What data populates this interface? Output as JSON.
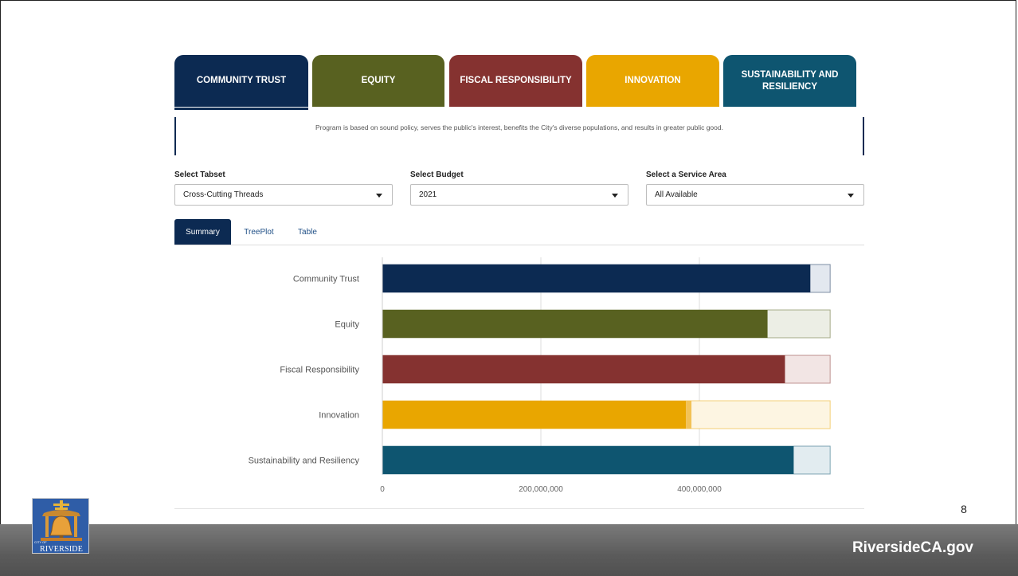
{
  "tabs": [
    {
      "label": "COMMUNITY TRUST",
      "color": "#0c2a52",
      "active": true
    },
    {
      "label": "EQUITY",
      "color": "#586120",
      "active": false
    },
    {
      "label": "FISCAL RESPONSIBILITY",
      "color": "#853230",
      "active": false
    },
    {
      "label": "INNOVATION",
      "color": "#e9a600",
      "active": false
    },
    {
      "label": "SUSTAINABILITY AND RESILIENCY",
      "color": "#0e5570",
      "active": false
    }
  ],
  "description": "Program is based on sound policy, serves the public's interest, benefits the City's diverse populations, and results in greater public good.",
  "selects": {
    "tabset": {
      "label": "Select Tabset",
      "value": "Cross-Cutting Threads"
    },
    "budget": {
      "label": "Select Budget",
      "value": "2021"
    },
    "service_area": {
      "label": "Select a Service Area",
      "value": "All Available"
    }
  },
  "subtabs": [
    "Summary",
    "TreePlot",
    "Table"
  ],
  "chart_data": {
    "type": "bar",
    "orientation": "horizontal",
    "stacked": true,
    "categories": [
      "Community Trust",
      "Equity",
      "Fiscal Responsibility",
      "Innovation",
      "Sustainability and Resiliency"
    ],
    "colors": [
      "#0c2a52",
      "#586120",
      "#853230",
      "#e9a600",
      "#0e5570"
    ],
    "light_colors": [
      "#e3e8ef",
      "#eceee5",
      "#f2e5e4",
      "#fdf5e2",
      "#e2ecf0"
    ],
    "values": [
      540000000,
      486000000,
      508000000,
      383000000,
      519000000
    ],
    "totals": [
      565000000,
      565000000,
      565000000,
      565000000,
      565000000
    ],
    "innovation_segment": 7000000,
    "xlim": [
      0,
      600000000
    ],
    "xticks": [
      0,
      200000000,
      400000000
    ],
    "xtick_labels": [
      "0",
      "200,000,000",
      "400,000,000"
    ],
    "grid": true
  },
  "page_number": "8",
  "footer": {
    "site": "RiversideCA.gov"
  },
  "logo": {
    "city_of": "CITY OF",
    "name": "RIVERSIDE"
  }
}
